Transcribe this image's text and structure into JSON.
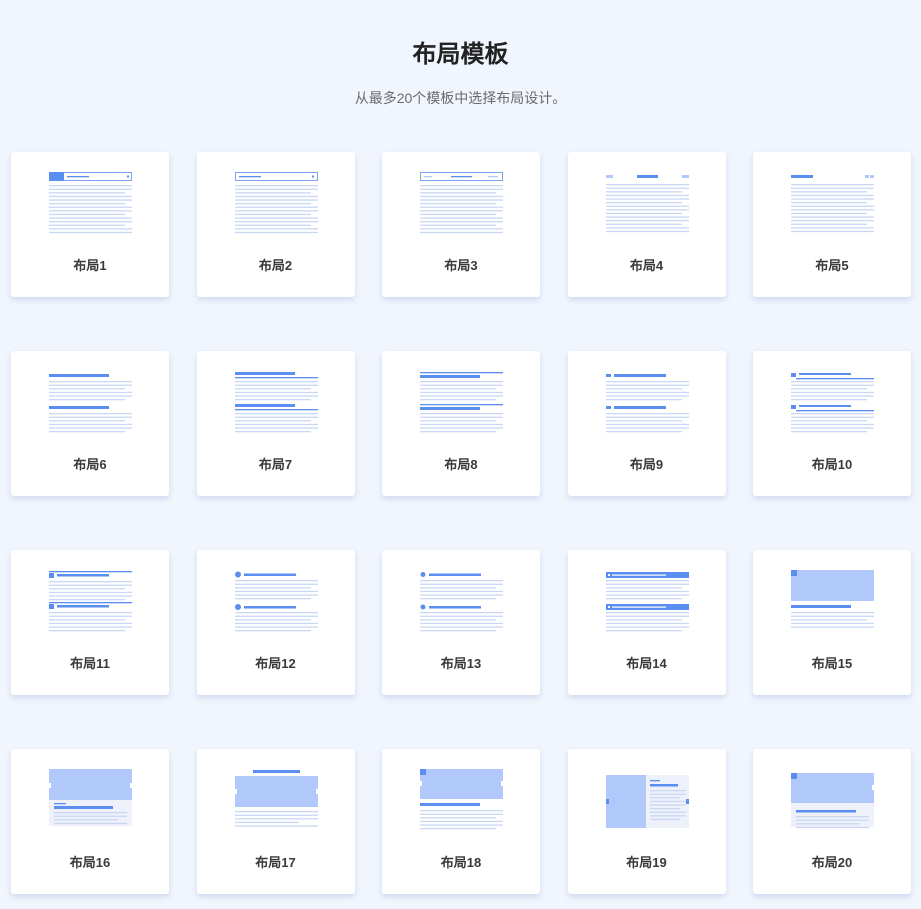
{
  "header": {
    "title": "布局模板",
    "subtitle": "从最多20个模板中选择布局设计。"
  },
  "colors": {
    "background": "#f1f5fd",
    "accent": "#5a8ef0",
    "light_line": "#c9d7f5",
    "image_block": "#b0c8fa"
  },
  "layouts": [
    {
      "id": 1,
      "label": "布局1"
    },
    {
      "id": 2,
      "label": "布局2"
    },
    {
      "id": 3,
      "label": "布局3"
    },
    {
      "id": 4,
      "label": "布局4"
    },
    {
      "id": 5,
      "label": "布局5"
    },
    {
      "id": 6,
      "label": "布局6"
    },
    {
      "id": 7,
      "label": "布局7"
    },
    {
      "id": 8,
      "label": "布局8"
    },
    {
      "id": 9,
      "label": "布局9"
    },
    {
      "id": 10,
      "label": "布局10"
    },
    {
      "id": 11,
      "label": "布局11"
    },
    {
      "id": 12,
      "label": "布局12"
    },
    {
      "id": 13,
      "label": "布局13"
    },
    {
      "id": 14,
      "label": "布局14"
    },
    {
      "id": 15,
      "label": "布局15"
    },
    {
      "id": 16,
      "label": "布局16"
    },
    {
      "id": 17,
      "label": "布局17"
    },
    {
      "id": 18,
      "label": "布局18"
    },
    {
      "id": 19,
      "label": "布局19"
    },
    {
      "id": 20,
      "label": "布局20"
    }
  ]
}
